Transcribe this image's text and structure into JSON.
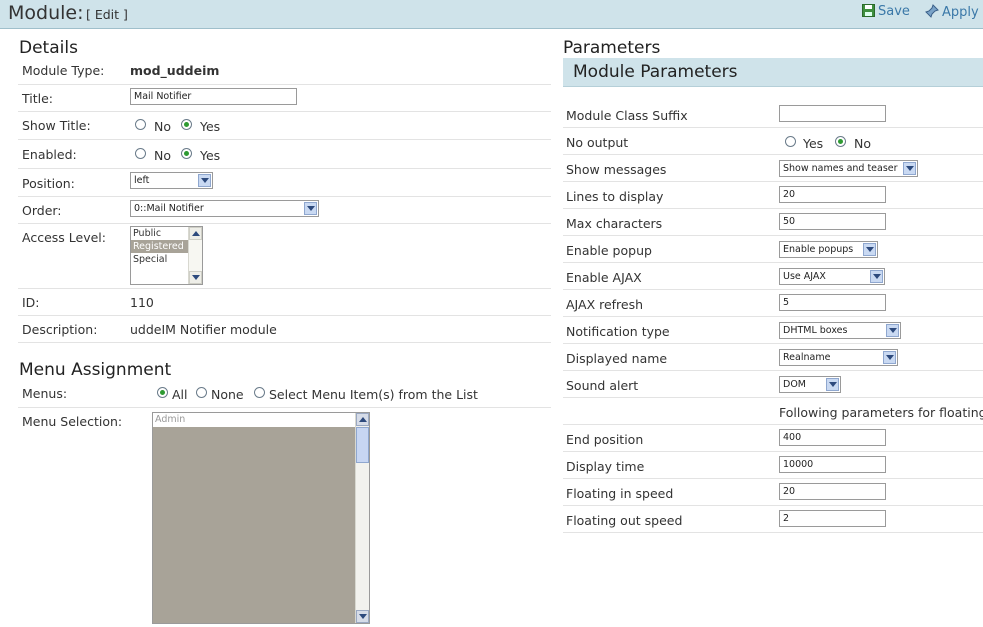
{
  "header": {
    "title": "Module:",
    "edit_label": "[ Edit ]",
    "save_label": "Save",
    "apply_label": "Apply"
  },
  "details": {
    "section_title": "Details",
    "module_type_label": "Module Type:",
    "module_type_value": "mod_uddeim",
    "title_label": "Title:",
    "title_value": "Mail Notifier",
    "show_title_label": "Show Title:",
    "enabled_label": "Enabled:",
    "no_label": "No",
    "yes_label": "Yes",
    "position_label": "Position:",
    "position_value": "left",
    "order_label": "Order:",
    "order_value": "0::Mail Notifier",
    "access_label": "Access Level:",
    "access_options": [
      "Public",
      "Registered",
      "Special"
    ],
    "id_label": "ID:",
    "id_value": "110",
    "description_label": "Description:",
    "description_value": "uddeIM Notifier module"
  },
  "menu_assignment": {
    "section_title": "Menu Assignment",
    "menus_label": "Menus:",
    "all_label": "All",
    "none_label": "None",
    "select_label": "Select Menu Item(s) from the List",
    "selection_label": "Menu Selection:",
    "selection_first_item": "Admin"
  },
  "parameters": {
    "section_title": "Parameters",
    "panel_title": "Module Parameters",
    "module_class_suffix_label": "Module Class Suffix",
    "module_class_suffix_value": "",
    "no_output_label": "No output",
    "yes_label": "Yes",
    "no_label": "No",
    "show_messages_label": "Show messages",
    "show_messages_value": "Show names and teaser",
    "lines_label": "Lines to display",
    "lines_value": "20",
    "max_chars_label": "Max characters",
    "max_chars_value": "50",
    "popup_label": "Enable popup",
    "popup_value": "Enable popups",
    "ajax_label": "Enable AJAX",
    "ajax_value": "Use AJAX",
    "ajax_refresh_label": "AJAX refresh",
    "ajax_refresh_value": "5",
    "notification_label": "Notification type",
    "notification_value": "DHTML boxes",
    "displayed_name_label": "Displayed name",
    "displayed_name_value": "Realname",
    "sound_label": "Sound alert",
    "sound_value": "DOM",
    "following_note": "Following parameters for floating",
    "end_position_label": "End position",
    "end_position_value": "400",
    "display_time_label": "Display time",
    "display_time_value": "10000",
    "float_in_label": "Floating in speed",
    "float_in_value": "20",
    "float_out_label": "Floating out speed",
    "float_out_value": "2"
  },
  "colors": {
    "header_bg": "#cfe3ea",
    "link": "#3a78a8",
    "radio_checked": "#2e9a32",
    "selected_option": "#a8a398"
  }
}
